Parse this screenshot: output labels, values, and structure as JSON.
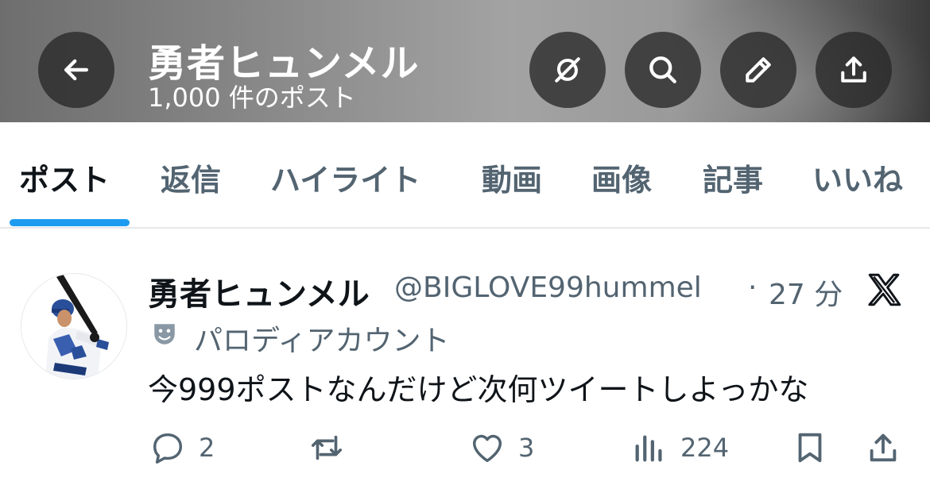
{
  "header": {
    "title": "勇者ヒュンメル",
    "post_count": "1,000 件のポスト",
    "icons": [
      "arrow-left-icon",
      "grok-icon",
      "search-icon",
      "pencil-icon",
      "share-icon"
    ]
  },
  "tabs": [
    {
      "label": "ポスト",
      "active": true
    },
    {
      "label": "返信"
    },
    {
      "label": "ハイライト"
    },
    {
      "label": "動画"
    },
    {
      "label": "画像"
    },
    {
      "label": "記事"
    },
    {
      "label": "いいね"
    }
  ],
  "tweet": {
    "display_name": "勇者ヒュンメル",
    "handle": "@BIGLOVE99hummel",
    "separator": "·",
    "time": "27 分",
    "parody_label": "パロディアカウント",
    "text": "今999ポストなんだけど次何ツイートしよっかな",
    "actions": {
      "replies": "2",
      "reposts": "",
      "likes": "3",
      "views": "224"
    }
  },
  "colors": {
    "accent": "#1d9bf0",
    "text_primary": "#0f1419",
    "text_secondary": "#536471"
  }
}
